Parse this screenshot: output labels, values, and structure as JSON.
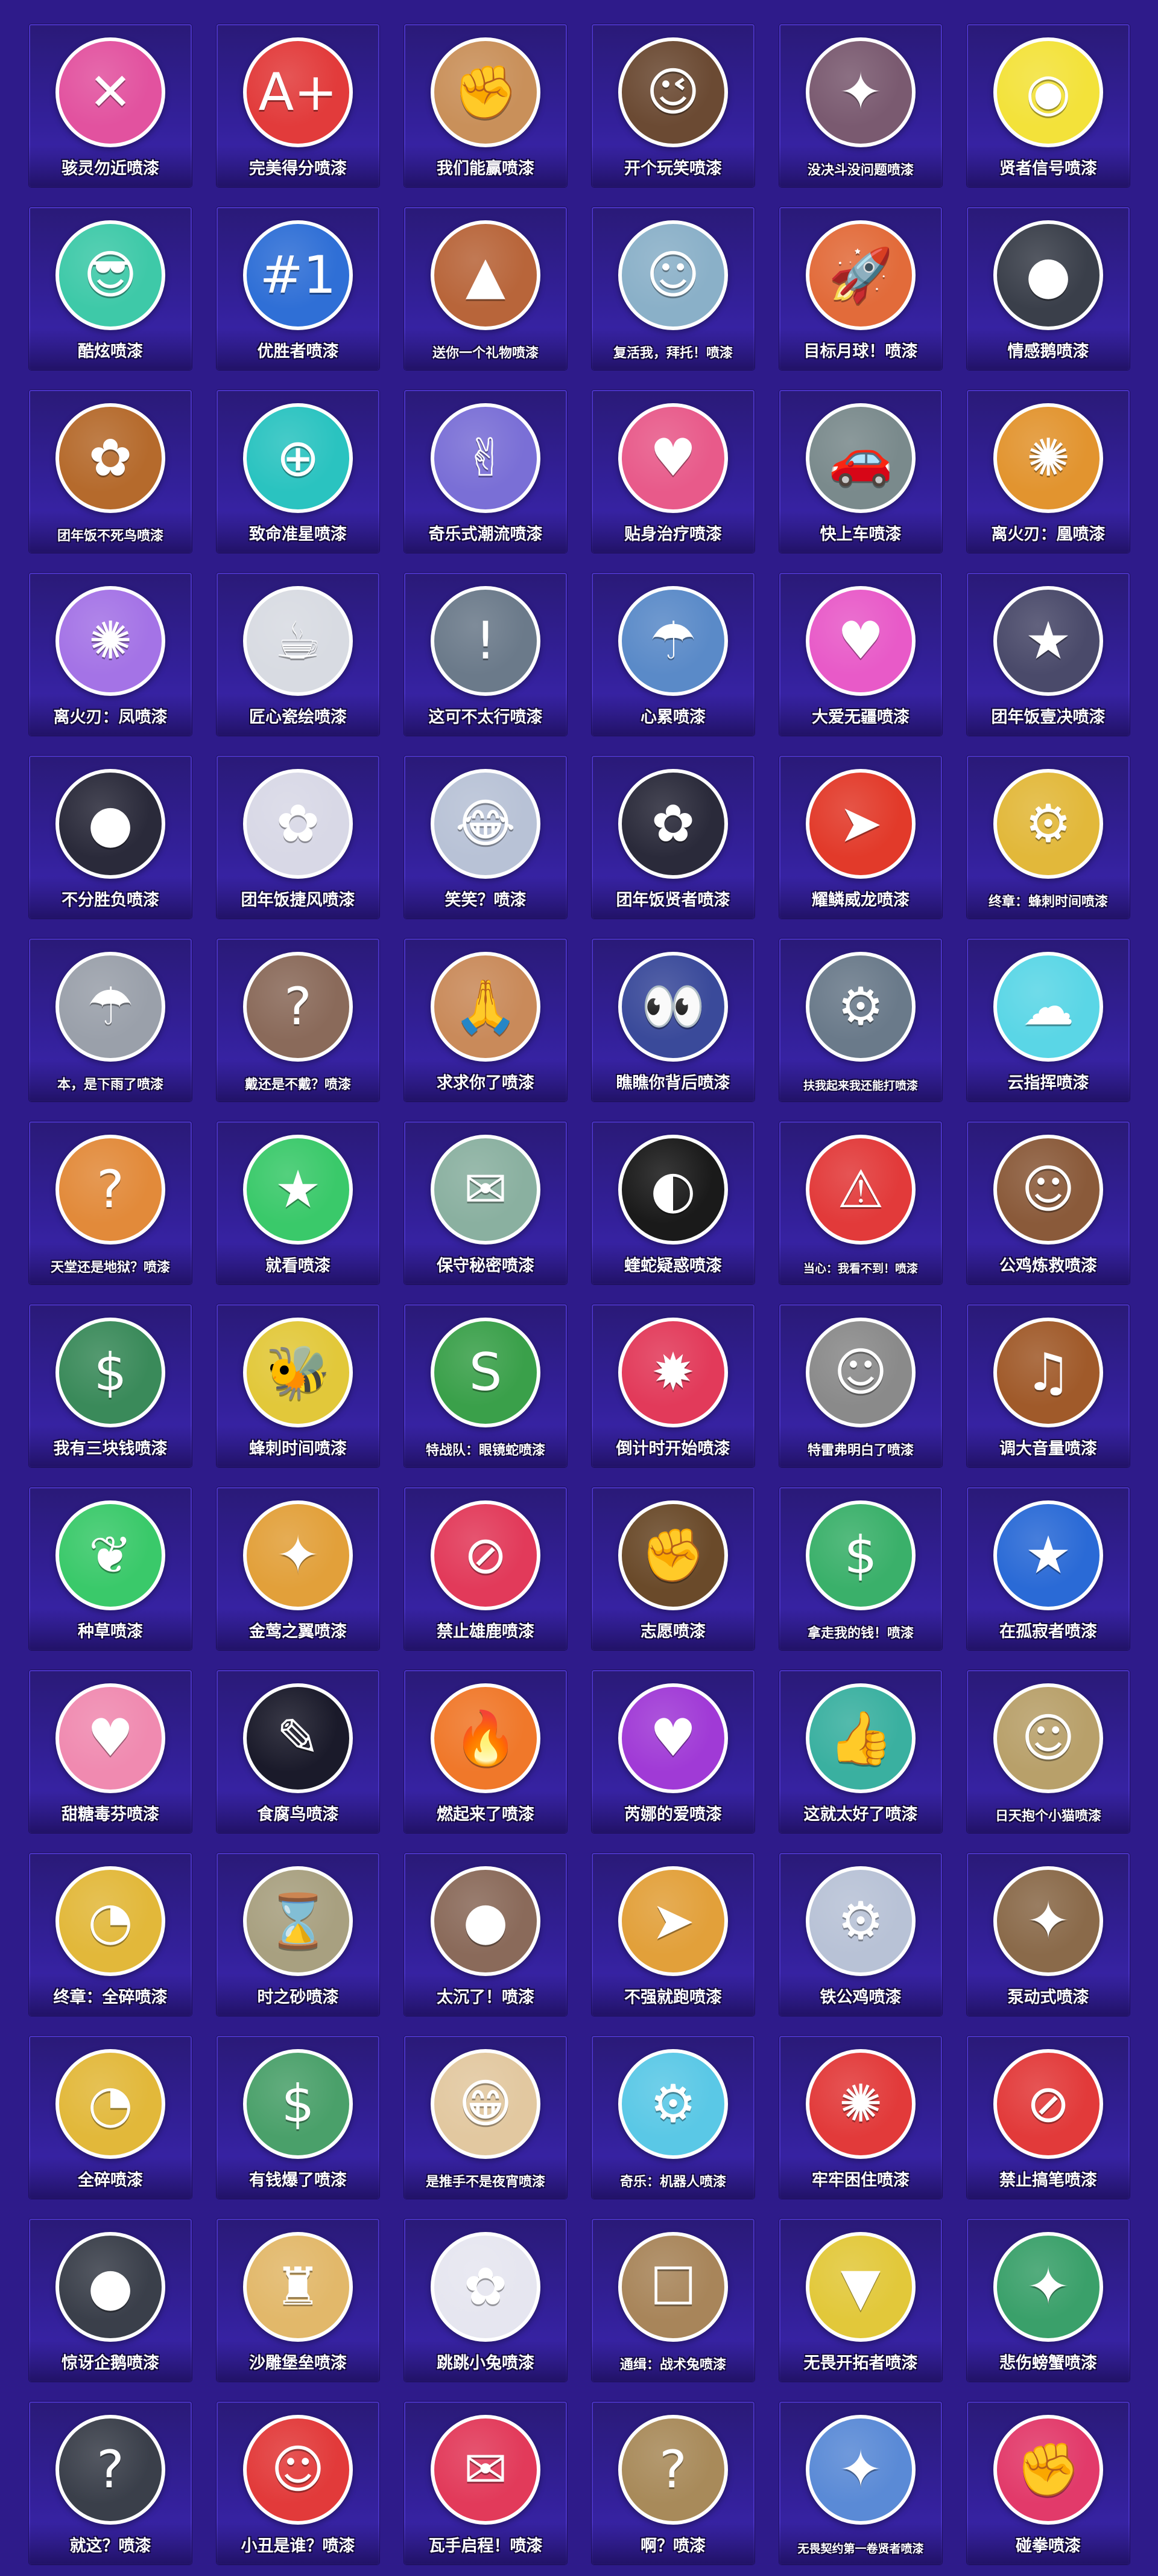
{
  "page": {
    "background": "#2e1b8a",
    "tile_border": "#4a33c4"
  },
  "sprays": [
    {
      "label": "骇灵勿近喷漆",
      "icon": "rifle-icon",
      "color": "#e2529f",
      "glyph": "✕"
    },
    {
      "label": "完美得分喷漆",
      "icon": "a-plus-icon",
      "color": "#e23b3b",
      "glyph": "A+"
    },
    {
      "label": "我们能赢喷漆",
      "icon": "flexing-agent-icon",
      "color": "#c9905a",
      "glyph": "✊"
    },
    {
      "label": "开个玩笑喷漆",
      "icon": "winking-agent-icon",
      "color": "#6b4a33",
      "glyph": "😉"
    },
    {
      "label": "没决斗没问题喷漆",
      "icon": "agent-with-gun-icon",
      "color": "#7a5a70",
      "glyph": "✦"
    },
    {
      "label": "贤者信号喷漆",
      "icon": "signal-light-icon",
      "color": "#f3e23a",
      "glyph": "◉"
    },
    {
      "label": "酷炫喷漆",
      "icon": "cool-agent-icon",
      "color": "#3ec9a8",
      "glyph": "😎"
    },
    {
      "label": "优胜者喷漆",
      "icon": "ribbon-medal-icon",
      "color": "#2f6fd6",
      "glyph": "#1"
    },
    {
      "label": "送你一个礼物喷漆",
      "icon": "gift-cones-icon",
      "color": "#b8653a",
      "glyph": "▲"
    },
    {
      "label": "复活我，拜托！喷漆",
      "icon": "pleading-agent-icon",
      "color": "#8ab0c8",
      "glyph": "☺"
    },
    {
      "label": "目标月球！喷漆",
      "icon": "rocket-icon",
      "color": "#e26b3a",
      "glyph": "🚀"
    },
    {
      "label": "情感鹅喷漆",
      "icon": "penguin-icon",
      "color": "#3a3f4a",
      "glyph": "●"
    },
    {
      "label": "团年饭不死鸟喷漆",
      "icon": "phoenix-dinner-icon",
      "color": "#b56a2c",
      "glyph": "✿"
    },
    {
      "label": "致命准星喷漆",
      "icon": "crosshair-icon",
      "color": "#2ac3c0",
      "glyph": "⊕"
    },
    {
      "label": "奇乐式潮流喷漆",
      "icon": "bunny-hand-icon",
      "color": "#7a6fd6",
      "glyph": "✌"
    },
    {
      "label": "贴身治疗喷漆",
      "icon": "revive-me-card-icon",
      "color": "#e85a8a",
      "glyph": "♥"
    },
    {
      "label": "快上车喷漆",
      "icon": "car-icon",
      "color": "#7a8a8c",
      "glyph": "🚗"
    },
    {
      "label": "离火刃：凰喷漆",
      "icon": "fire-phoenix-pattern-icon",
      "color": "#e2942f",
      "glyph": "✺"
    },
    {
      "label": "离火刃：凤喷漆",
      "icon": "purple-phoenix-pattern-icon",
      "color": "#a473e6",
      "glyph": "✺"
    },
    {
      "label": "匠心瓷绘喷漆",
      "icon": "teapot-icon",
      "color": "#d8dbe2",
      "glyph": "☕"
    },
    {
      "label": "这可不太行喷漆",
      "icon": "shocked-agent-icon",
      "color": "#6b7a8a",
      "glyph": "!"
    },
    {
      "label": "心累喷漆",
      "icon": "rain-cloud-icon",
      "color": "#5a8ac8",
      "glyph": "☂"
    },
    {
      "label": "大爱无疆喷漆",
      "icon": "love-hate-text-icon",
      "color": "#e85ac8",
      "glyph": "♥"
    },
    {
      "label": "团年饭壹决喷漆",
      "icon": "agent-dinner-icon",
      "color": "#4a4a6a",
      "glyph": "★"
    },
    {
      "label": "不分胜负喷漆",
      "icon": "seated-agent-icon",
      "color": "#2a2a3a",
      "glyph": "●"
    },
    {
      "label": "团年饭捷风喷漆",
      "icon": "jett-dinner-icon",
      "color": "#d8d8e6",
      "glyph": "✿"
    },
    {
      "label": "笑笑？喷漆",
      "icon": "laughing-agent-icon",
      "color": "#b8c2d6",
      "glyph": "😂"
    },
    {
      "label": "团年饭贤者喷漆",
      "icon": "sage-dinner-icon",
      "color": "#2a2a3a",
      "glyph": "✿"
    },
    {
      "label": "耀鳞威龙喷漆",
      "icon": "golden-wings-icon",
      "color": "#e23a2a",
      "glyph": "➤"
    },
    {
      "label": "终章：蜂刺时间喷漆",
      "icon": "gold-bee-gun-icon",
      "color": "#e2b83a",
      "glyph": "⚙"
    },
    {
      "label": "本，是下雨了喷漆",
      "icon": "rain-hat-pattern-icon",
      "color": "#9aa0aa",
      "glyph": "☂"
    },
    {
      "label": "戴还是不戴？喷漆",
      "icon": "two-agents-icon",
      "color": "#8a6a5a",
      "glyph": "?"
    },
    {
      "label": "求求你了喷漆",
      "icon": "begging-agent-icon",
      "color": "#c98a5a",
      "glyph": "🙏"
    },
    {
      "label": "瞧瞧你背后喷漆",
      "icon": "behind-you-icon",
      "color": "#3a4a9a",
      "glyph": "👀"
    },
    {
      "label": "扶我起来我还能打喷漆",
      "icon": "fallen-robot-icon",
      "color": "#6a7a8a",
      "glyph": "⚙"
    },
    {
      "label": "云指挥喷漆",
      "icon": "cloud-agent-icon",
      "color": "#5ad6e6",
      "glyph": "☁"
    },
    {
      "label": "天堂还是地狱？喷漆",
      "icon": "headset-agent-icon",
      "color": "#e28a3a",
      "glyph": "?"
    },
    {
      "label": "就看喷漆",
      "icon": "hat-agent-icon",
      "color": "#3ac96a",
      "glyph": "★"
    },
    {
      "label": "保守秘密喷漆",
      "icon": "secret-bird-icon",
      "color": "#8ab0a0",
      "glyph": "✉"
    },
    {
      "label": "蝰蛇疑惑喷漆",
      "icon": "masked-viper-icon",
      "color": "#1a1a1a",
      "glyph": "◐"
    },
    {
      "label": "当心：我看不到！喷漆",
      "icon": "warning-sign-icon",
      "color": "#e23a3a",
      "glyph": "⚠"
    },
    {
      "label": "公鸡炼救喷漆",
      "icon": "bearded-agent-icon",
      "color": "#8a5a3a",
      "glyph": "☺"
    },
    {
      "label": "我有三块钱喷漆",
      "icon": "money-agent-icon",
      "color": "#3a8a5a",
      "glyph": "$"
    },
    {
      "label": "蜂刺时间喷漆",
      "icon": "bee-gun-icon",
      "color": "#e2c83a",
      "glyph": "🐝"
    },
    {
      "label": "特战队：眼镜蛇喷漆",
      "icon": "snake-emblem-icon",
      "color": "#3aa04a",
      "glyph": "S"
    },
    {
      "label": "倒计时开始喷漆",
      "icon": "fireworks-icon",
      "color": "#e23a5a",
      "glyph": "✹"
    },
    {
      "label": "特雷弗明白了喷漆",
      "icon": "sloth-icon",
      "color": "#8a8a8a",
      "glyph": "☺"
    },
    {
      "label": "调大音量喷漆",
      "icon": "speaker-icon",
      "color": "#a05a2a",
      "glyph": "♫"
    },
    {
      "label": "种草喷漆",
      "icon": "plant-lantern-icon",
      "color": "#3ac96a",
      "glyph": "❦"
    },
    {
      "label": "金莺之翼喷漆",
      "icon": "golden-oriole-icon",
      "color": "#e2a03a",
      "glyph": "✦"
    },
    {
      "label": "禁止雄鹿喷漆",
      "icon": "no-deer-icon",
      "color": "#e23a5a",
      "glyph": "⊘"
    },
    {
      "label": "志愿喷漆",
      "icon": "raised-fist-agent-icon",
      "color": "#6a4a2a",
      "glyph": "✊"
    },
    {
      "label": "拿走我的钱！喷漆",
      "icon": "cash-agent-icon",
      "color": "#3ab06a",
      "glyph": "$"
    },
    {
      "label": "在孤寂者喷漆",
      "icon": "seated-blue-agent-icon",
      "color": "#2a6ad6",
      "glyph": "★"
    },
    {
      "label": "甜糖毒芬喷漆",
      "icon": "cupcake-icon",
      "color": "#f08ab0",
      "glyph": "♥"
    },
    {
      "label": "食腐鸟喷漆",
      "icon": "heron-outline-icon",
      "color": "#1a1a2a",
      "glyph": "✎"
    },
    {
      "label": "燃起来了喷漆",
      "icon": "campfire-icon",
      "color": "#f0782a",
      "glyph": "🔥"
    },
    {
      "label": "芮娜的爱喷漆",
      "icon": "reyna-heart-icon",
      "color": "#a03ad6",
      "glyph": "♥"
    },
    {
      "label": "这就太好了喷漆",
      "icon": "thumbs-agent-icon",
      "color": "#3ab0a0",
      "glyph": "👍"
    },
    {
      "label": "日天抱个小猫喷漆",
      "icon": "cat-icon",
      "color": "#b8a06a",
      "glyph": "☺"
    },
    {
      "label": "终章：全碎喷漆",
      "icon": "broken-egg-icon",
      "color": "#e2b83a",
      "glyph": "◔"
    },
    {
      "label": "时之砂喷漆",
      "icon": "sand-tools-icon",
      "color": "#a8a080",
      "glyph": "⌛"
    },
    {
      "label": "太沉了！喷漆",
      "icon": "heavy-sack-icon",
      "color": "#8a6a5a",
      "glyph": "●"
    },
    {
      "label": "不强就跑喷漆",
      "icon": "running-agents-icon",
      "color": "#e2a03a",
      "glyph": "➤"
    },
    {
      "label": "铁公鸡喷漆",
      "icon": "metal-rooster-icon",
      "color": "#b8c2d6",
      "glyph": "⚙"
    },
    {
      "label": "泵动式喷漆",
      "icon": "shotgun-agent-icon",
      "color": "#8a6a4a",
      "glyph": "✦"
    },
    {
      "label": "全碎喷漆",
      "icon": "cracked-egg-icon",
      "color": "#e2b83a",
      "glyph": "◔"
    },
    {
      "label": "有钱爆了喷漆",
      "icon": "money-pile-icon",
      "color": "#4aa06a",
      "glyph": "$"
    },
    {
      "label": "是推手不是夜宵喷漆",
      "icon": "grinning-agent-icon",
      "color": "#e2c8a0",
      "glyph": "😁"
    },
    {
      "label": "奇乐：机器人喷漆",
      "icon": "robot-friend-icon",
      "color": "#5ac8e6",
      "glyph": "⚙"
    },
    {
      "label": "牢牢困住喷漆",
      "icon": "octopus-icon",
      "color": "#e23a3a",
      "glyph": "✺"
    },
    {
      "label": "禁止搞笔喷漆",
      "icon": "no-pen-icon",
      "color": "#e23a3a",
      "glyph": "⊘"
    },
    {
      "label": "惊讶企鹅喷漆",
      "icon": "surprised-penguin-icon",
      "color": "#3a3f4a",
      "glyph": "●"
    },
    {
      "label": "沙雕堡垒喷漆",
      "icon": "sandcastle-icon",
      "color": "#e2b86a",
      "glyph": "♜"
    },
    {
      "label": "跳跳小兔喷漆",
      "icon": "bunny-pattern-icon",
      "color": "#e6e6f0",
      "glyph": "✿"
    },
    {
      "label": "通缉：战术兔喷漆",
      "icon": "wanted-poster-icon",
      "color": "#a8855a",
      "glyph": "☐"
    },
    {
      "label": "无畏开拓者喷漆",
      "icon": "triangle-pattern-icon",
      "color": "#e2c83a",
      "glyph": "▼"
    },
    {
      "label": "悲伤螃蟹喷漆",
      "icon": "crab-icon",
      "color": "#3aa06a",
      "glyph": "✦"
    },
    {
      "label": "就这？喷漆",
      "icon": "question-penguin-icon",
      "color": "#3a3f4a",
      "glyph": "?"
    },
    {
      "label": "小丑是谁？喷漆",
      "icon": "clown-icon",
      "color": "#e23a3a",
      "glyph": "☺"
    },
    {
      "label": "瓦手启程！喷漆",
      "icon": "speech-bubble-icon",
      "color": "#e23a5a",
      "glyph": "✉"
    },
    {
      "label": "啊？喷漆",
      "icon": "grumpy-cat-icon",
      "color": "#a88a5a",
      "glyph": "?"
    },
    {
      "label": "无畏契约第一卷贤者喷漆",
      "icon": "leaping-sage-icon",
      "color": "#5a8ad6",
      "glyph": "✦"
    },
    {
      "label": "碰拳喷漆",
      "icon": "fist-bump-icon",
      "color": "#e23a6a",
      "glyph": "✊"
    }
  ]
}
